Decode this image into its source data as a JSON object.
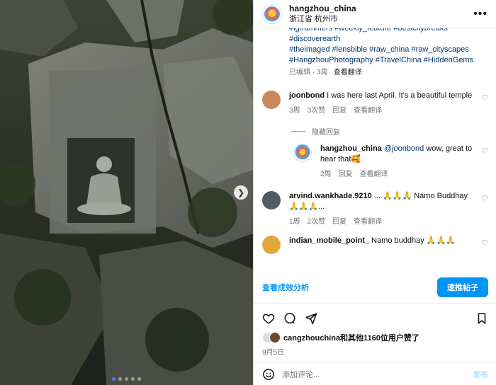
{
  "header": {
    "username": "hangzhou_china",
    "location": "浙江省 杭州市",
    "more_icon": "more-horizontal-icon"
  },
  "caption": {
    "cut_line": "#igframmers #weekly_feature #bestcitybreaks",
    "lines": [
      "#discoverearth",
      "#theimaged #lensbible #raw_china #raw_cityscapes",
      "#HangzhouPhotography #TravelChina #HiddenGems"
    ],
    "meta": "已编辑 · 3周",
    "translate": "查看翻译"
  },
  "comments": [
    {
      "user": "joonbond",
      "text": "I was here last April. It's a beautiful temple",
      "time": "3周",
      "likes": "3次赞",
      "reply": "回复",
      "translate": "查看翻译",
      "avatar_color": "#c98a5a"
    },
    {
      "user": "arvind.wankhade.9210",
      "text": "... 🙏🙏🙏 Namo Buddhay 🙏🙏🙏...",
      "time": "1周",
      "likes": "2次赞",
      "reply": "回复",
      "translate": "查看翻译",
      "avatar_color": "#555a60"
    },
    {
      "user": "indian_mobile_point_",
      "text": "Namo buddhay 🙏🙏🙏",
      "avatar_color": "#e0a93a"
    }
  ],
  "hide_replies": "隐藏回复",
  "reply": {
    "user": "hangzhou_china",
    "mention": "@joonbond",
    "text": "wow, great to hear that🥰",
    "time": "2周",
    "reply": "回复",
    "translate": "查看翻译"
  },
  "insights_label": "查看成效分析",
  "boost_label": "速推帖子",
  "likes_text": "cangzhouchina和其他1160位用户赞了",
  "date": "9月5日",
  "add_comment_placeholder": "添加评论...",
  "post_label": "发布",
  "colors": {
    "accent": "#0095f6",
    "link": "#00376b",
    "muted": "#737373"
  },
  "carousel": {
    "total": 5,
    "active": 1
  }
}
